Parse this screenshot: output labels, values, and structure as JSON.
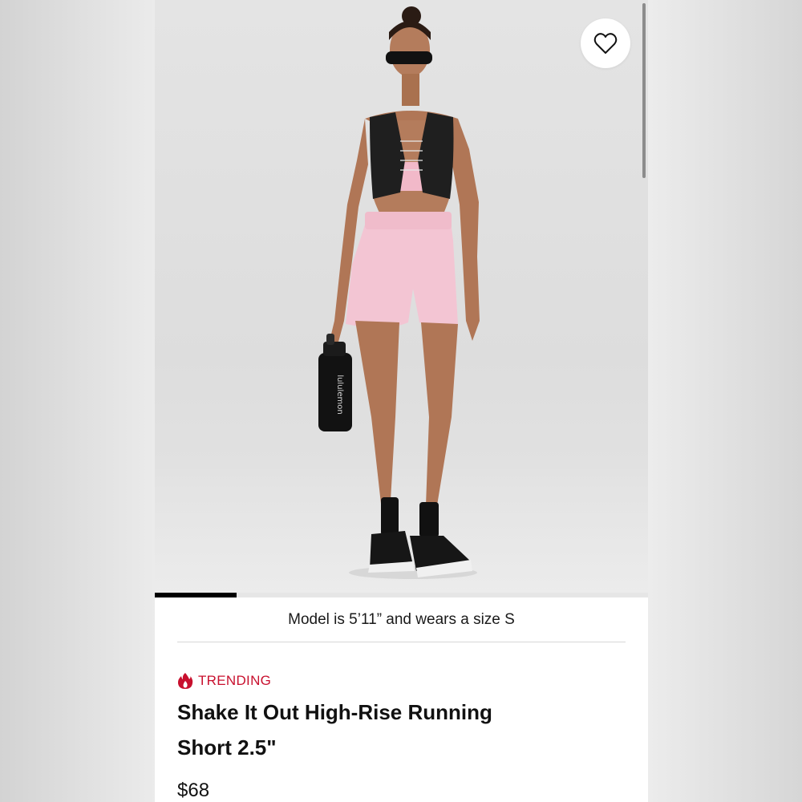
{
  "product": {
    "image_alt": "Model wearing pink running shorts, black vest and holding a water bottle",
    "bottle_brand": "lululemon",
    "wishlist_icon": "heart-outline-icon",
    "gallery_progress": 0.166,
    "caption": "Model is 5’11” and wears a size S",
    "badge": {
      "icon": "flame-icon",
      "label": "TRENDING",
      "color": "#c8102e"
    },
    "title_line1": "Shake It Out High-Rise Running",
    "title_line2": "Short 2.5\"",
    "price": "$68"
  }
}
